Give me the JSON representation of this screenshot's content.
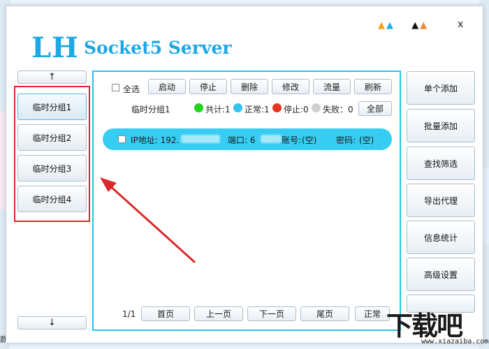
{
  "window": {
    "title_main": "LH",
    "title_sub": "Socket5 Server",
    "close": "x"
  },
  "sidebar": {
    "up": "↑",
    "down": "↓",
    "groups": [
      "临时分组1",
      "临时分组2",
      "临时分组3",
      "临时分组4"
    ],
    "active_index": 0
  },
  "toolbar": {
    "select_all": "全选",
    "start": "启动",
    "stop": "停止",
    "delete": "删除",
    "edit": "修改",
    "traffic": "流量",
    "refresh": "刷新"
  },
  "status": {
    "group_name": "临时分组1",
    "total": "共计:1",
    "normal": "正常:1",
    "stopped": "停止:0",
    "failed": "失败：0",
    "all_button": "全部",
    "colors": {
      "total": "#23d31e",
      "normal": "#33c3f0",
      "stopped": "#e8331f",
      "failed": "#cfcfcf"
    }
  },
  "list": {
    "rows": [
      {
        "ip_label": "IP地址: 192.",
        "port_label": "端口: 6",
        "account_label": "账号:",
        "account_value": "(空)",
        "password_label": "密码:",
        "password_value": "(空)"
      }
    ]
  },
  "pagination": {
    "page_indicator": "1/1",
    "first": "首页",
    "prev": "上一页",
    "next": "下一页",
    "last": "尾页",
    "mode": "正常"
  },
  "actions": {
    "buttons": [
      "单个添加",
      "批量添加",
      "查找筛选",
      "导出代理",
      "信息统计",
      "高级设置"
    ]
  },
  "watermark": {
    "main": "下载吧",
    "sub": "www.xiazaiba.com"
  },
  "background": {
    "bottom_left_text": "款"
  }
}
